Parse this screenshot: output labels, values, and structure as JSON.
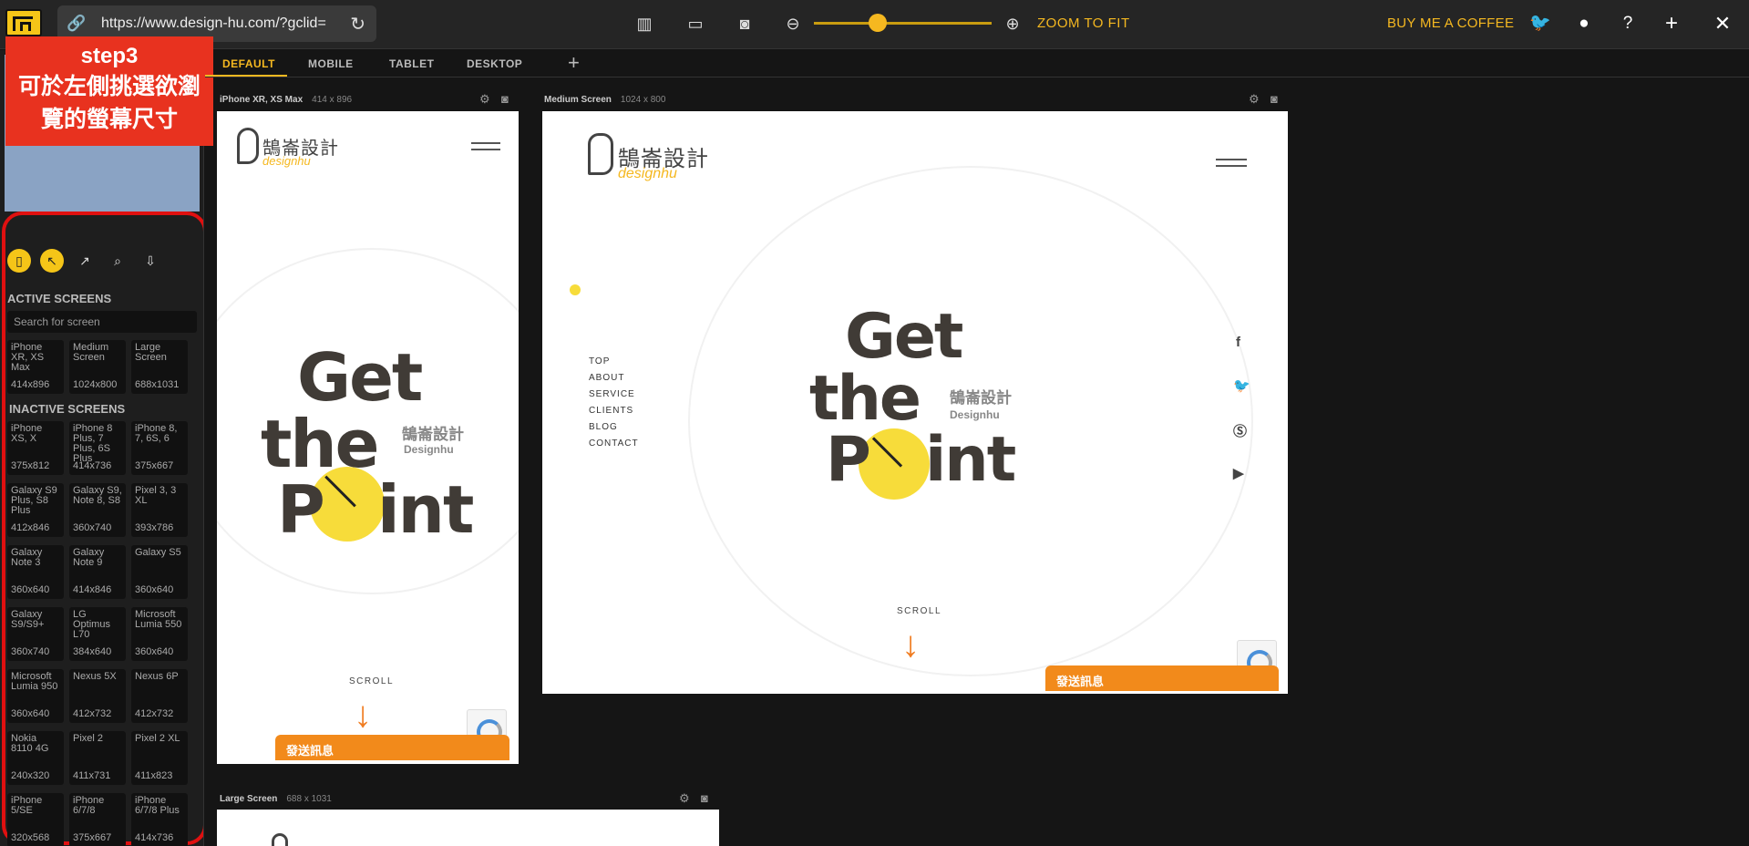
{
  "toolbar": {
    "url": "https://www.design-hu.com/?gclid=",
    "zoom_to_fit": "ZOOM TO FIT",
    "buy_coffee": "BUY ME A COFFEE"
  },
  "annotation": {
    "step": "step3",
    "line1": "可於左側挑選欲瀏",
    "line2": "覽的螢幕尺寸"
  },
  "sidebar": {
    "active_heading": "ACTIVE SCREENS",
    "search_placeholder": "Search for screen",
    "inactive_heading": "INACTIVE SCREENS",
    "active": [
      {
        "name": "iPhone XR, XS Max",
        "dims": "414x896"
      },
      {
        "name": "Medium Screen",
        "dims": "1024x800"
      },
      {
        "name": "Large Screen",
        "dims": "688x1031"
      }
    ],
    "inactive": [
      {
        "name": "iPhone XS, X",
        "dims": "375x812"
      },
      {
        "name": "iPhone 8 Plus, 7 Plus, 6S Plus",
        "dims": "414x736"
      },
      {
        "name": "iPhone 8, 7, 6S, 6",
        "dims": "375x667"
      },
      {
        "name": "Galaxy S9 Plus, S8 Plus",
        "dims": "412x846"
      },
      {
        "name": "Galaxy S9, Note 8, S8",
        "dims": "360x740"
      },
      {
        "name": "Pixel 3, 3 XL",
        "dims": "393x786"
      },
      {
        "name": "Galaxy Note 3",
        "dims": "360x640"
      },
      {
        "name": "Galaxy Note 9",
        "dims": "414x846"
      },
      {
        "name": "Galaxy S5",
        "dims": "360x640"
      },
      {
        "name": "Galaxy S9/S9+",
        "dims": "360x740"
      },
      {
        "name": "LG Optimus L70",
        "dims": "384x640"
      },
      {
        "name": "Microsoft Lumia 550",
        "dims": "360x640"
      },
      {
        "name": "Microsoft Lumia 950",
        "dims": "360x640"
      },
      {
        "name": "Nexus 5X",
        "dims": "412x732"
      },
      {
        "name": "Nexus 6P",
        "dims": "412x732"
      },
      {
        "name": "Nokia 8110 4G",
        "dims": "240x320"
      },
      {
        "name": "Pixel 2",
        "dims": "411x731"
      },
      {
        "name": "Pixel 2 XL",
        "dims": "411x823"
      },
      {
        "name": "iPhone 5/SE",
        "dims": "320x568"
      },
      {
        "name": "iPhone 6/7/8",
        "dims": "375x667"
      },
      {
        "name": "iPhone 6/7/8 Plus",
        "dims": "414x736"
      }
    ]
  },
  "tabs": [
    "DEFAULT",
    "MOBILE",
    "TABLET",
    "DESKTOP"
  ],
  "devices": {
    "phone": {
      "label": "iPhone XR, XS Max",
      "size": "414 x 896"
    },
    "medium": {
      "label": "Medium Screen",
      "size": "1024 x 800"
    },
    "large": {
      "label": "Large Screen",
      "size": "688 x 1031"
    }
  },
  "site": {
    "logo_cn": "鵠崙設計",
    "logo_en": "designhu",
    "hero_l1": "Get",
    "hero_l2": "the",
    "hero_l3a": "P",
    "hero_l3b": "int",
    "hero_cn": "鵠崙設計",
    "hero_en": "Designhu",
    "scroll": "SCROLL",
    "send": "發送訊息",
    "nav": [
      "TOP",
      "ABOUT",
      "SERVICE",
      "CLIENTS",
      "BLOG",
      "CONTACT"
    ]
  },
  "colors": {
    "accent": "#f5b820",
    "annotation_red": "#e8321f",
    "send_orange": "#f28a1b"
  }
}
